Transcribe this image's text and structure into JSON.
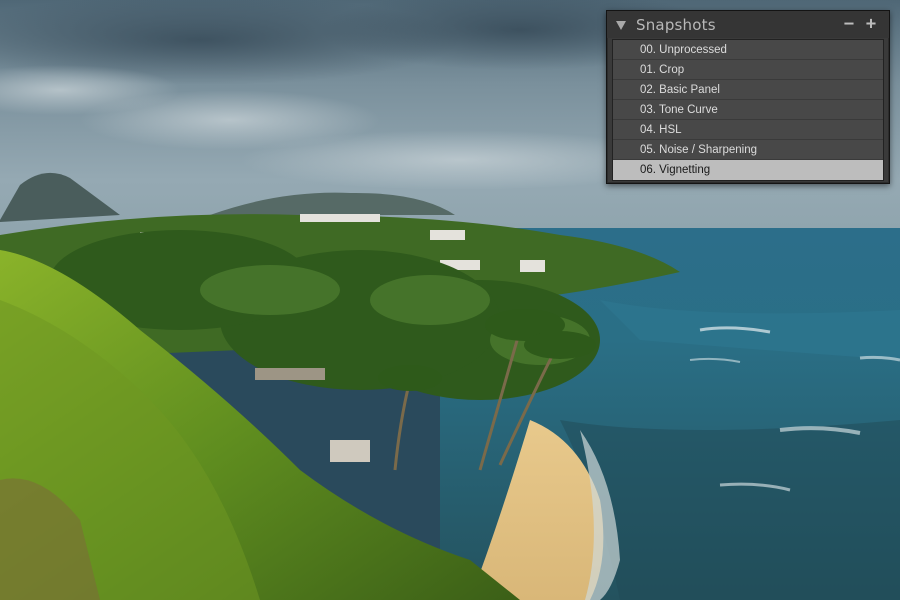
{
  "panel": {
    "title": "Snapshots",
    "collapse_icon": "triangle-down-icon",
    "remove_label": "−",
    "add_label": "+"
  },
  "snapshots": [
    {
      "label": "00. Unprocessed"
    },
    {
      "label": "01. Crop"
    },
    {
      "label": "02. Basic Panel"
    },
    {
      "label": "03. Tone Curve"
    },
    {
      "label": "04. HSL"
    },
    {
      "label": "05. Noise / Sharpening"
    },
    {
      "label": "06. Vignetting"
    }
  ],
  "selected_index": 6,
  "colors": {
    "panel_bg": "#3a3a3a",
    "selected_bg": "#bdbdbd",
    "text": "#dcdcdc"
  }
}
